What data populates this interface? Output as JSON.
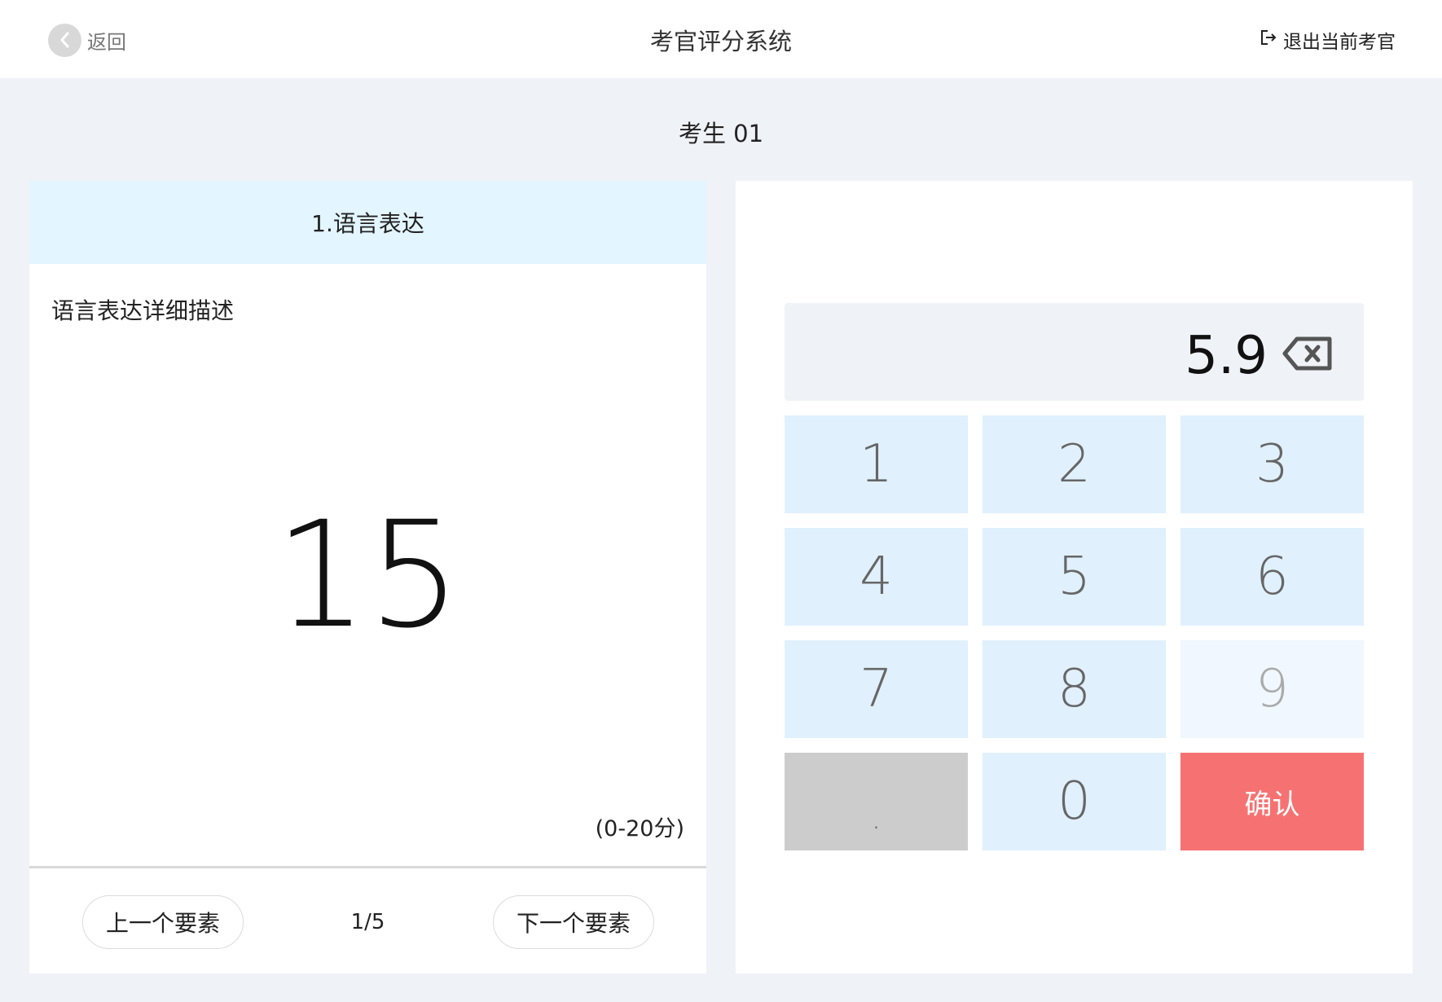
{
  "header": {
    "back_label": "返回",
    "title": "考官评分系统",
    "logout_label": "退出当前考官"
  },
  "candidate": {
    "name": "考生 01"
  },
  "item": {
    "title": "1.语言表达",
    "description": "语言表达详细描述",
    "score": "15",
    "range": "(0-20分)",
    "prev_label": "上一个要素",
    "next_label": "下一个要素",
    "pager": "1/5"
  },
  "keypad": {
    "input_value": "5.9",
    "keys": [
      "1",
      "2",
      "3",
      "4",
      "5",
      "6",
      "7",
      "8",
      "9",
      ".",
      "0"
    ],
    "confirm_label": "确认",
    "colors": {
      "key_bg": "#e0f0fd",
      "confirm_bg": "#f67272",
      "dot_bg": "#cccccc"
    }
  }
}
